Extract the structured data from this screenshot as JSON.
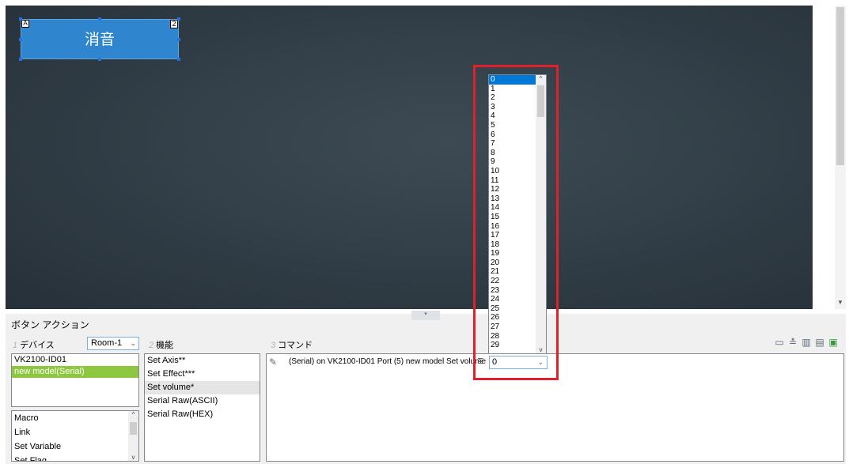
{
  "canvas": {
    "mute_button": {
      "label": "消音",
      "badge_left": "A",
      "badge_right": "2"
    }
  },
  "panel": {
    "title": "ボタン アクション",
    "steps": [
      {
        "num": "1",
        "label": "デバイス"
      },
      {
        "num": "2",
        "label": "機能"
      },
      {
        "num": "3",
        "label": "コマンド"
      }
    ],
    "room_select": "Room-1",
    "devices": [
      "VK2100-ID01",
      "new model(Serial)"
    ],
    "selected_device": "new model(Serial)",
    "macros": [
      "Macro",
      "Link",
      "Set Variable",
      "Set Flag"
    ],
    "functions": [
      "Set Axis**",
      "Set Effect***",
      "Set volume*",
      "Serial Raw(ASCII)",
      "Serial Raw(HEX)"
    ],
    "selected_function": "Set volume*",
    "command": {
      "text": "(Serial) on VK2100-ID01 Port (5) new model Set volume",
      "value": "0"
    }
  },
  "dropdown": {
    "options": [
      "0",
      "1",
      "2",
      "3",
      "4",
      "5",
      "6",
      "7",
      "8",
      "9",
      "10",
      "11",
      "12",
      "13",
      "14",
      "15",
      "16",
      "17",
      "18",
      "19",
      "20",
      "21",
      "22",
      "23",
      "24",
      "25",
      "26",
      "27",
      "28",
      "29"
    ],
    "selected": "0"
  },
  "icons": {
    "toolbar": [
      "monitor-add-icon",
      "export-icon",
      "delete-icon",
      "copy-icon",
      "add-green-icon"
    ]
  },
  "colors": {
    "canvas_bg": "#34414a",
    "mute_button": "#2f86cf",
    "selection_green": "#8dc63f",
    "highlight_red": "#e0202a",
    "dropdown_highlight": "#0078d7"
  }
}
